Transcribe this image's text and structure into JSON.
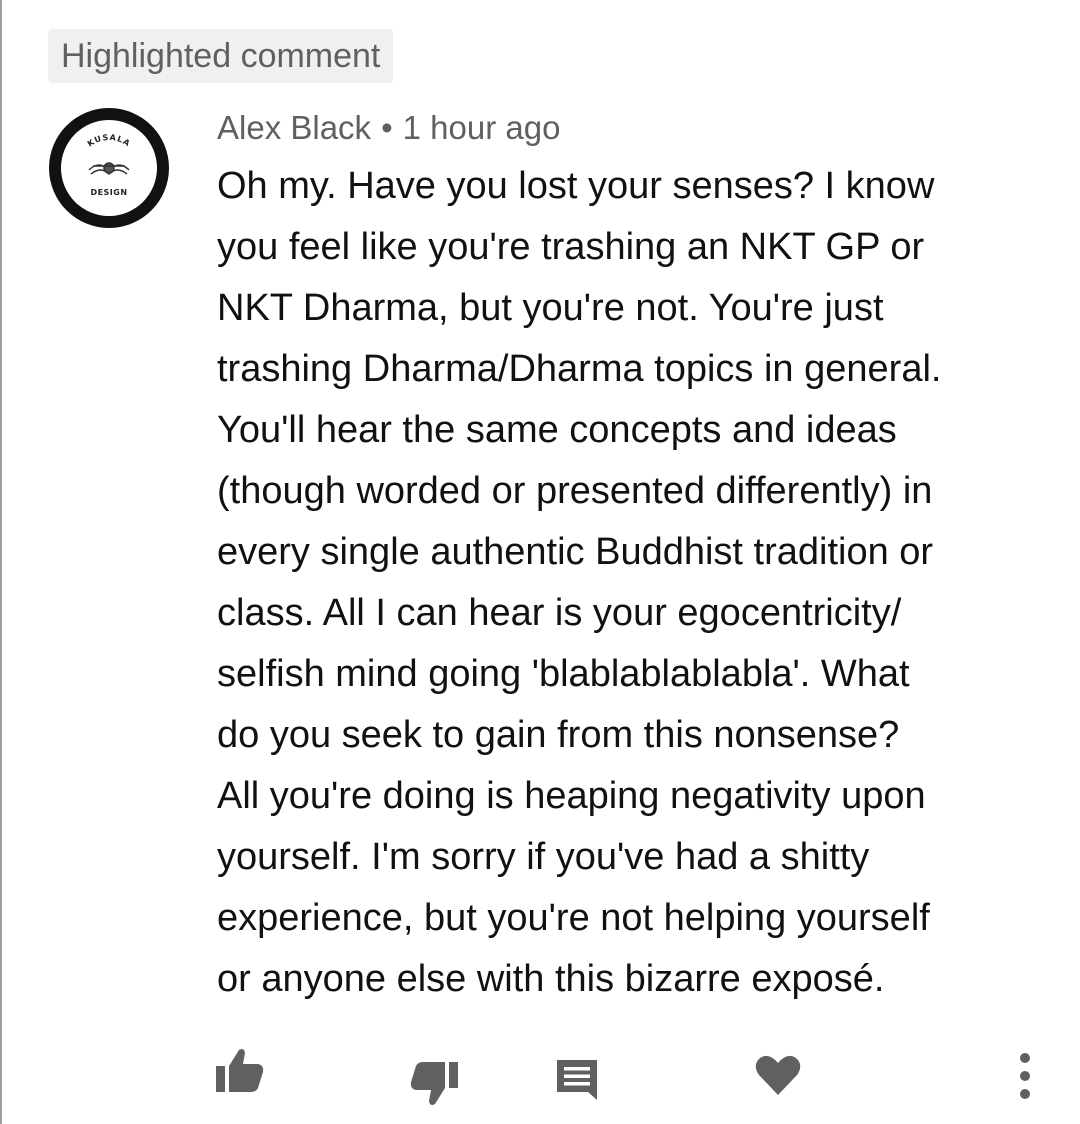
{
  "badge": {
    "label": "Highlighted comment"
  },
  "comment": {
    "author": "Alex Black",
    "separator": "•",
    "time": "1 hour ago",
    "avatar": {
      "brand_top": "KUSALA",
      "brand_bottom": "DESIGN"
    },
    "lines": [
      "Oh my. Have you lost your senses? I know",
      "you feel like you're trashing an NKT GP or",
      "NKT Dharma, but you're not. You're just",
      "trashing Dharma/Dharma topics in general.",
      "You'll hear the same concepts and ideas",
      "(though worded or presented differently) in",
      "every single authentic Buddhist tradition or",
      "class. All I can hear is your egocentricity/",
      "selfish mind going 'blablablablabla'. What",
      "do you seek to gain from this nonsense?",
      "All you're doing is heaping negativity upon",
      "yourself. I'm sorry if you've had a shitty",
      "experience, but you're not helping yourself",
      "or anyone else with this bizarre exposé."
    ]
  },
  "actions": {
    "like_icon": "thumb-up-icon",
    "dislike_icon": "thumb-down-icon",
    "reply_icon": "comment-icon",
    "heart_icon": "heart-icon",
    "menu_icon": "more-vertical-icon"
  },
  "colors": {
    "text": "#111111",
    "meta_text": "#606060",
    "icon": "#606060",
    "badge_background": "#f0f0f0"
  }
}
